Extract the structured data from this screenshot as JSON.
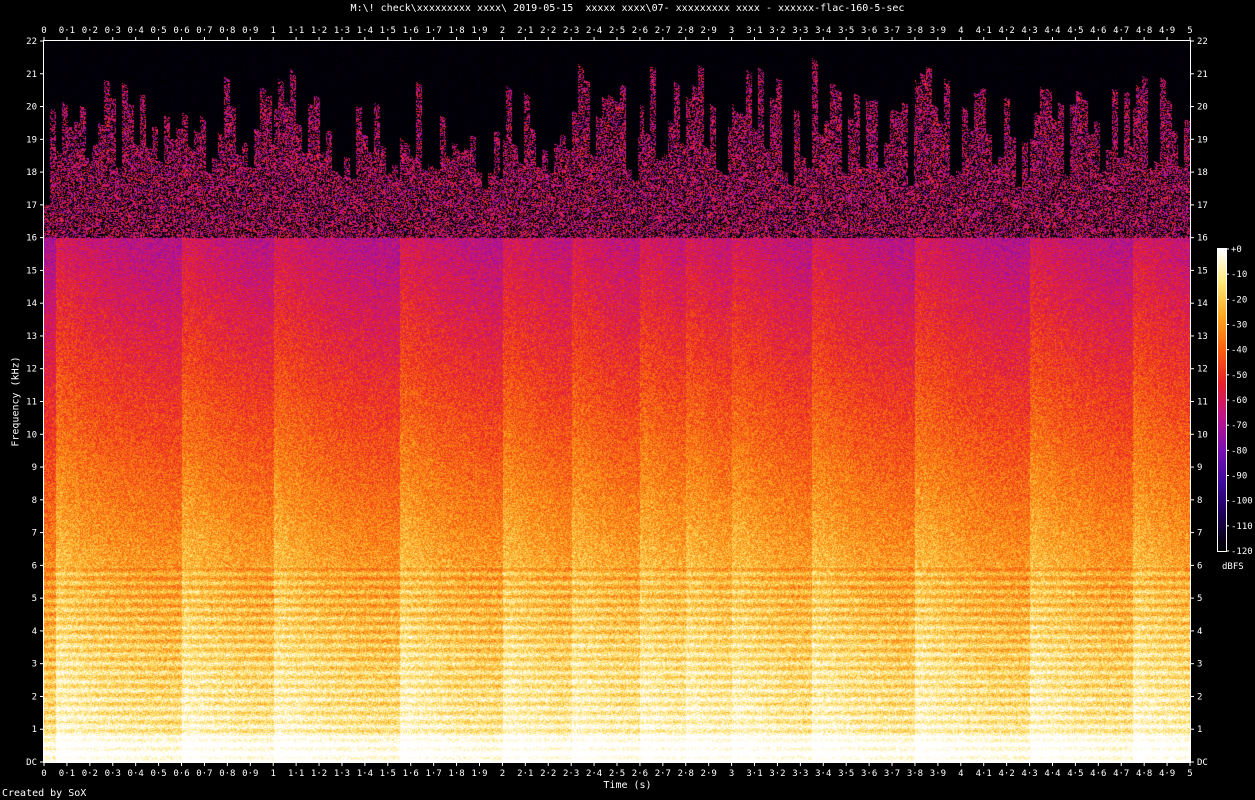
{
  "title": "M:\\! check\\xxxxxxxxx xxxx\\ 2019-05-15  xxxxx xxxx\\07- xxxxxxxxx xxxx - xxxxxx-flac-160-5-sec",
  "footer": "Created by SoX",
  "colorbar_unit": "dBFS",
  "chart_data": {
    "type": "heatmap",
    "title": "M:\\! check\\xxxxxxxxx xxxx\\ 2019-05-15  xxxxx xxxx\\07- xxxxxxxxx xxxx - xxxxxx-flac-160-5-sec",
    "xlabel": "Time (s)",
    "ylabel": "Frequency (kHz)",
    "xlim": [
      0,
      5
    ],
    "ylim": [
      0,
      22
    ],
    "x_ticks": [
      "0",
      "0·1",
      "0·2",
      "0·3",
      "0·4",
      "0·5",
      "0·6",
      "0·7",
      "0·8",
      "0·9",
      "1",
      "1·1",
      "1·2",
      "1·3",
      "1·4",
      "1·5",
      "1·6",
      "1·7",
      "1·8",
      "1·9",
      "2",
      "2·1",
      "2·2",
      "2·3",
      "2·4",
      "2·5",
      "2·6",
      "2·7",
      "2·8",
      "2·9",
      "3",
      "3·1",
      "3·2",
      "3·3",
      "3·4",
      "3·5",
      "3·6",
      "3·7",
      "3·8",
      "3·9",
      "4",
      "4·1",
      "4·2",
      "4·3",
      "4·4",
      "4·5",
      "4·6",
      "4·7",
      "4·8",
      "4·9",
      "5"
    ],
    "y_ticks": [
      "DC",
      "1",
      "2",
      "3",
      "4",
      "5",
      "6",
      "7",
      "8",
      "9",
      "10",
      "11",
      "12",
      "13",
      "14",
      "15",
      "16",
      "17",
      "18",
      "19",
      "20",
      "21",
      "22"
    ],
    "colorbar": {
      "label": "dBFS",
      "ticks": [
        "+0",
        "-10",
        "-20",
        "-30",
        "-40",
        "-50",
        "-60",
        "-70",
        "-80",
        "-90",
        "-100",
        "-110",
        "-120"
      ],
      "range": [
        -120,
        0
      ],
      "colors": [
        "#000000",
        "#1a0050",
        "#3c0a9a",
        "#7a10b0",
        "#c0148a",
        "#e8202a",
        "#f86010",
        "#fca820",
        "#fee878",
        "#ffffff"
      ]
    },
    "lowpass_cutoff_khz": 16,
    "onsets_s": [
      0.05,
      0.6,
      1.0,
      1.55,
      2.0,
      2.3,
      2.6,
      2.8,
      3.0,
      3.35,
      3.8,
      4.3,
      4.75
    ]
  }
}
